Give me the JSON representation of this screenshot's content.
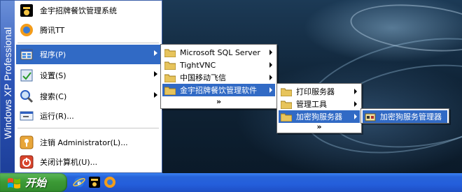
{
  "start_menu": {
    "brand": {
      "windows": "Windows",
      "xp": "XP",
      "edition": "Professional"
    },
    "pinned": [
      {
        "label": "金宇招牌餐饮管理系统",
        "icon": "chef-app-icon"
      },
      {
        "label": "腾讯TT",
        "icon": "tencent-tt-icon"
      }
    ],
    "items": [
      {
        "label": "程序(P)",
        "icon": "programs-icon",
        "selected": true,
        "submenu": true
      },
      {
        "label": "设置(S)",
        "icon": "settings-icon",
        "submenu": true
      },
      {
        "label": "搜索(C)",
        "icon": "search-icon",
        "submenu": true
      },
      {
        "label": "运行(R)...",
        "icon": "run-icon"
      }
    ],
    "footer": [
      {
        "label": "注销 Administrator(L)...",
        "icon": "logoff-icon"
      },
      {
        "label": "关闭计算机(U)...",
        "icon": "shutdown-icon"
      }
    ]
  },
  "programs_menu": {
    "items": [
      {
        "label": "Microsoft SQL Server",
        "submenu": true
      },
      {
        "label": "TightVNC",
        "submenu": true
      },
      {
        "label": "中国移动飞信",
        "submenu": true
      },
      {
        "label": "金宇招牌餐饮管理软件",
        "submenu": true,
        "selected": true
      }
    ],
    "expand": "»"
  },
  "jinyu_menu": {
    "items": [
      {
        "label": "打印服务器",
        "submenu": true
      },
      {
        "label": "管理工具",
        "submenu": true
      },
      {
        "label": "加密狗服务器",
        "submenu": true,
        "selected": true
      }
    ],
    "expand": "»"
  },
  "dongle_menu": {
    "items": [
      {
        "label": "加密狗服务管理器",
        "selected": true
      }
    ]
  },
  "taskbar": {
    "start_label": "开始",
    "quick_launch": [
      "ie-icon",
      "chef-app-icon",
      "tencent-tt-icon"
    ]
  },
  "colors": {
    "selection": "#316ac5",
    "taskbar": "#245edb",
    "start_button": "#3c9a36"
  }
}
